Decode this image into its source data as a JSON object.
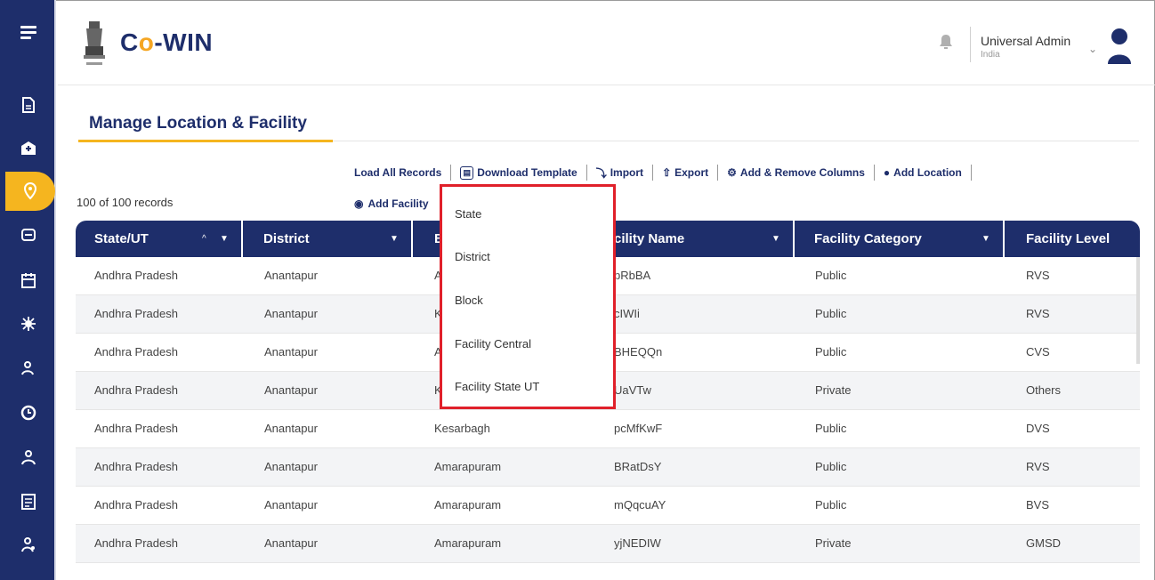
{
  "app": {
    "logo_text": "Co-WIN",
    "user_name": "Universal Admin",
    "user_region": "India"
  },
  "sidebar": {
    "items": [
      {
        "icon": "menu-icon"
      },
      {
        "icon": "document-icon"
      },
      {
        "icon": "hospital-icon"
      },
      {
        "icon": "location-icon"
      },
      {
        "icon": "vaccination-center-icon"
      },
      {
        "icon": "calendar-icon"
      },
      {
        "icon": "virus-icon"
      },
      {
        "icon": "vaccinator-icon"
      },
      {
        "icon": "reports-icon"
      },
      {
        "icon": "users-icon"
      },
      {
        "icon": "register-icon"
      },
      {
        "icon": "admin-icon"
      }
    ],
    "colors": {
      "background": "#1e2e6b",
      "active": "#f5b51f"
    }
  },
  "page": {
    "title": "Manage Location & Facility",
    "records_count": "100 of 100 records"
  },
  "toolbar": {
    "load_all": "Load All Records",
    "download_template": "Download Template",
    "import": "Import",
    "export": "Export",
    "add_remove_columns": "Add & Remove Columns",
    "add_location": "Add Location",
    "add_facility": "Add Facility"
  },
  "table": {
    "headers": [
      "State/UT",
      "District",
      "B",
      "cility Name",
      "Facility Category",
      "Facility Level"
    ],
    "rows": [
      [
        "Andhra Pradesh",
        "Anantapur",
        "A",
        "pRbBA",
        "Public",
        "RVS"
      ],
      [
        "Andhra Pradesh",
        "Anantapur",
        "K",
        "cIWIi",
        "Public",
        "RVS"
      ],
      [
        "Andhra Pradesh",
        "Anantapur",
        "A",
        "BHEQQn",
        "Public",
        "CVS"
      ],
      [
        "Andhra Pradesh",
        "Anantapur",
        "K",
        "UaVTw",
        "Private",
        "Others"
      ],
      [
        "Andhra Pradesh",
        "Anantapur",
        "Kesarbagh",
        "pcMfKwF",
        "Public",
        "DVS"
      ],
      [
        "Andhra Pradesh",
        "Anantapur",
        "Amarapuram",
        "BRatDsY",
        "Public",
        "RVS"
      ],
      [
        "Andhra Pradesh",
        "Anantapur",
        "Amarapuram",
        "mQqcuAY",
        "Public",
        "BVS"
      ],
      [
        "Andhra Pradesh",
        "Anantapur",
        "Amarapuram",
        "yjNEDIW",
        "Private",
        "GMSD"
      ]
    ]
  },
  "dropdown": {
    "items": [
      "State",
      "District",
      "Block",
      "Facility Central",
      "Facility State UT"
    ],
    "highlight_color": "#e0202a"
  }
}
